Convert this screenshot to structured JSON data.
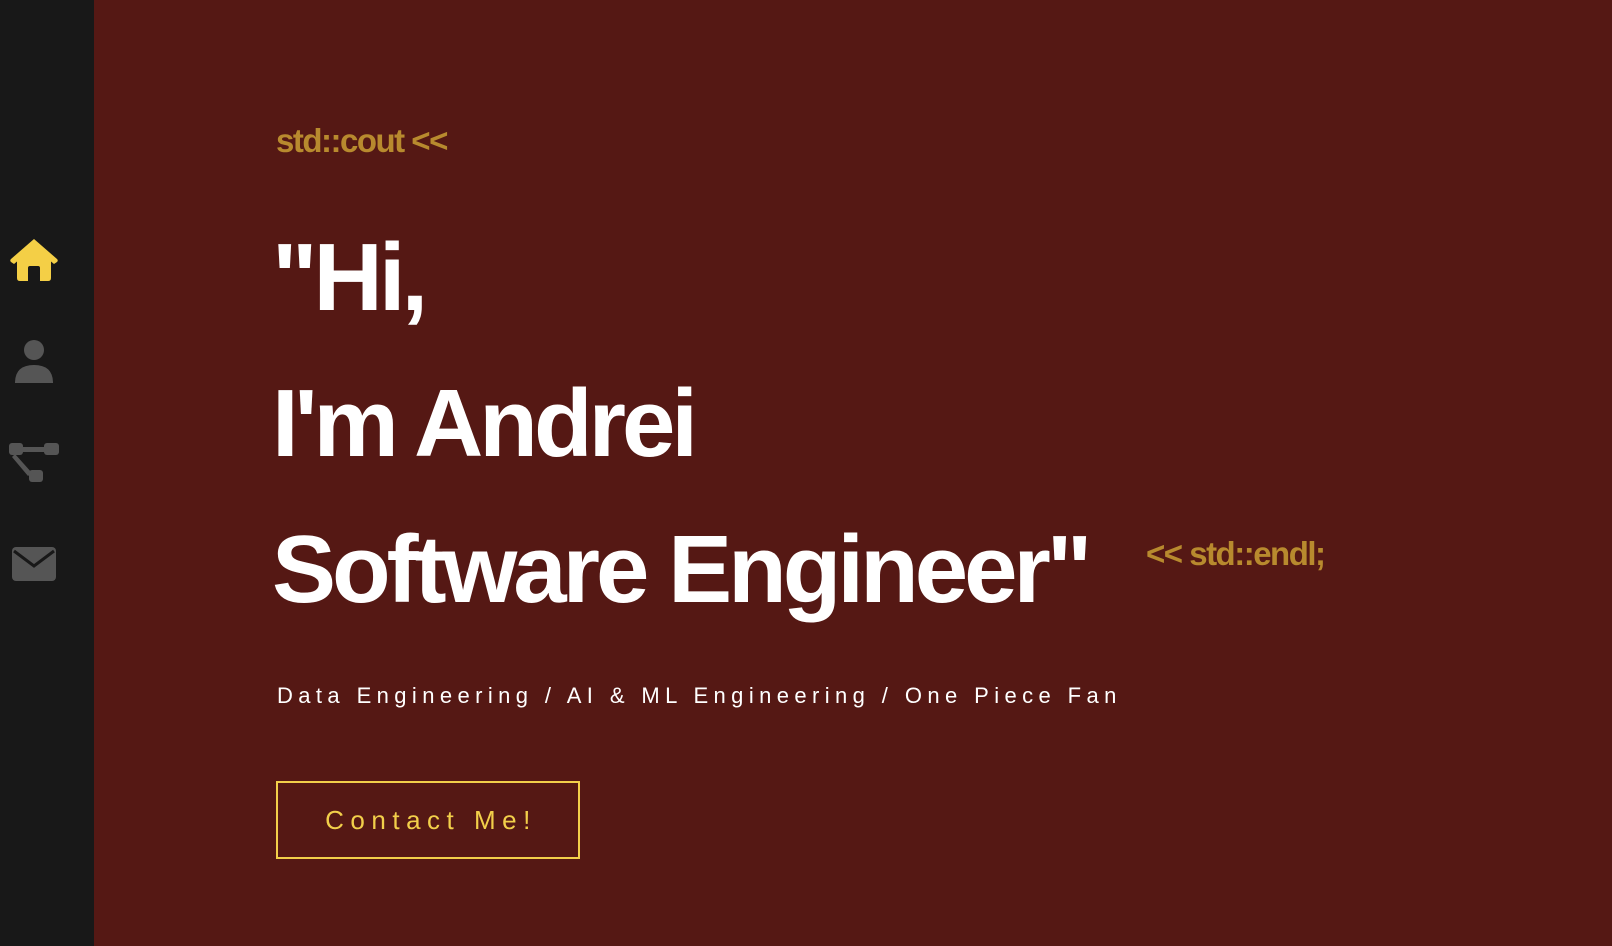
{
  "sidebar": {
    "items": [
      {
        "icon": "home-icon",
        "active": true
      },
      {
        "icon": "user-icon",
        "active": false
      },
      {
        "icon": "sitemap-icon",
        "active": false
      },
      {
        "icon": "envelope-icon",
        "active": false
      }
    ],
    "colors": {
      "active": "#f4cf46",
      "inactive": "#555555",
      "background": "#181818"
    }
  },
  "hero": {
    "code_prefix": "std::cout <<",
    "line1": "\"Hi,",
    "line2": "I'm Andrei",
    "line3": "Software Engineer\"",
    "code_suffix": "<< std::endl;",
    "tagline": "Data Engineering / AI & ML Engineering / One Piece Fan",
    "contact_label": "Contact Me!"
  },
  "colors": {
    "background": "#551814",
    "accent": "#f2cf4a",
    "code": "#b88a2e",
    "text": "#ffffff"
  }
}
